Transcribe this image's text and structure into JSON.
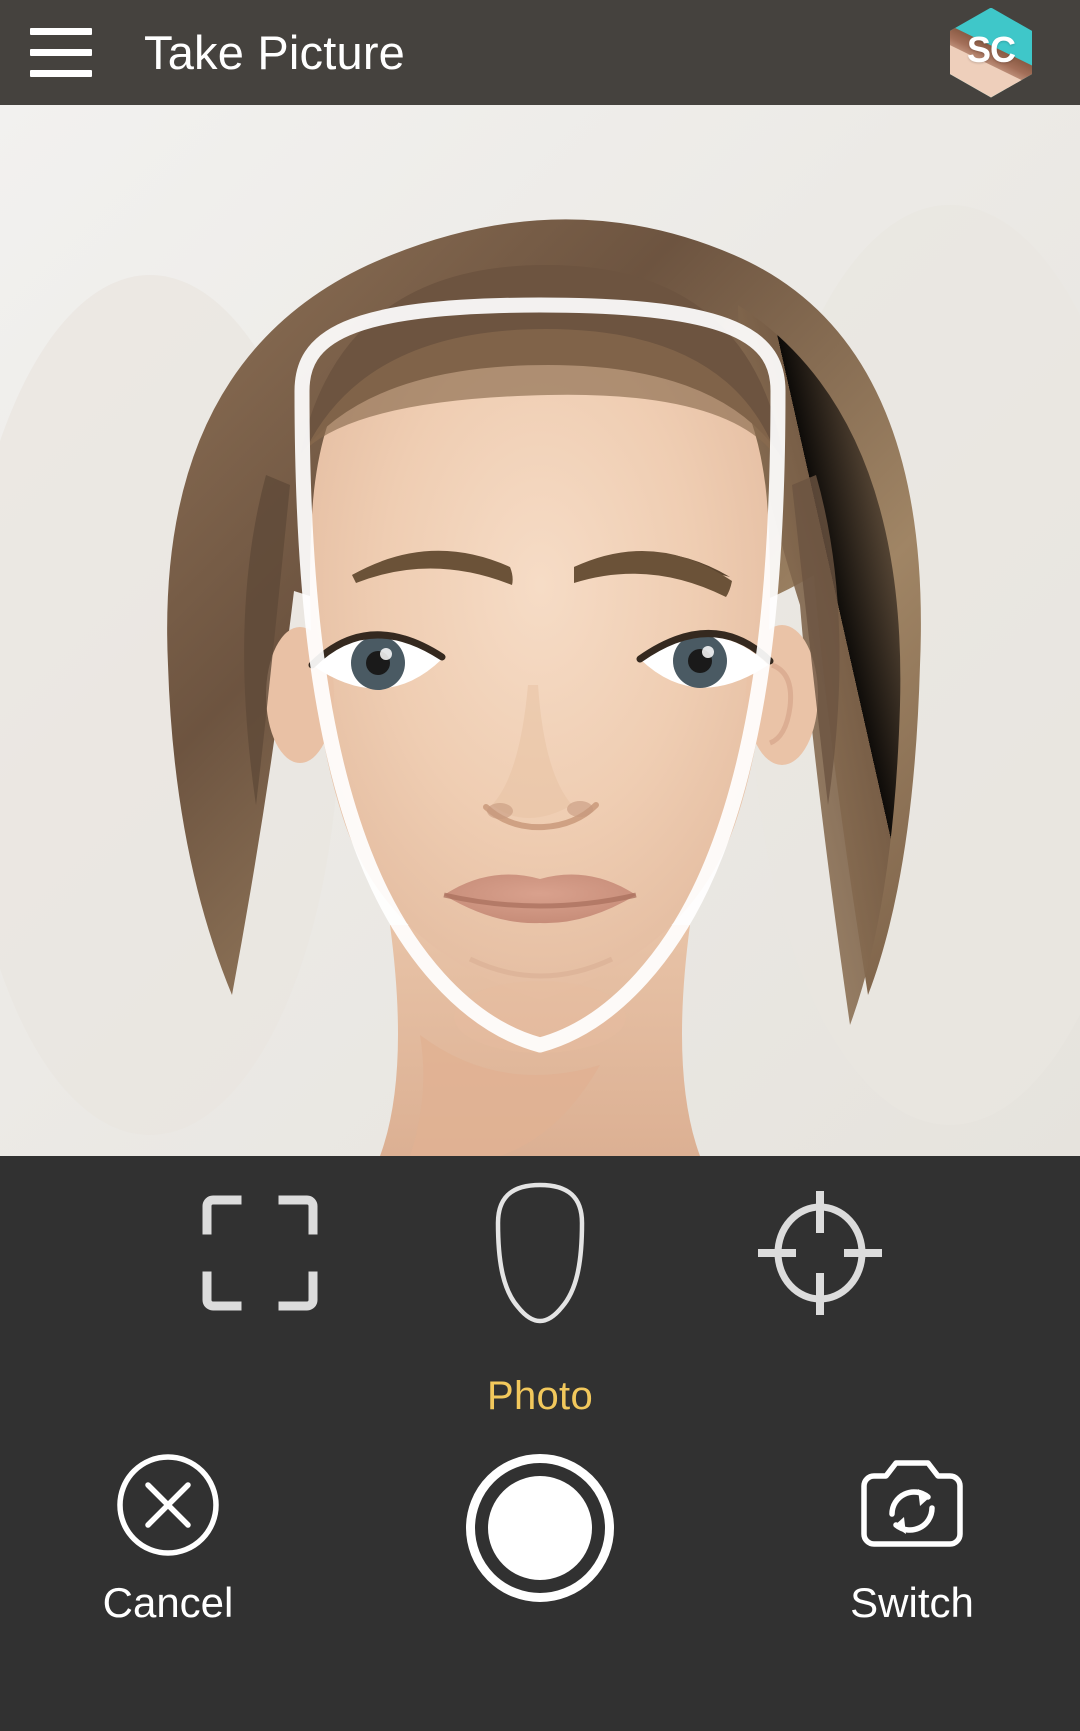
{
  "appbar": {
    "menu_icon": "hamburger-menu-icon",
    "title": "Take Picture",
    "logo": {
      "icon": "app-logo-hexagon-icon",
      "text": "SC",
      "background_color": "#3fc7c9"
    },
    "background_color": "#45423e",
    "title_color": "#ffffff"
  },
  "viewfinder": {
    "subject": "woman face portrait preview",
    "guide_overlay": {
      "icon": "face-outline-guide",
      "color": "#ffffff",
      "description": "white rounded face alignment outline"
    },
    "background_color": "#edecea"
  },
  "controls": {
    "background_color": "#313131",
    "modes": [
      {
        "icon": "crop-frame-icon",
        "name": "crop-frame",
        "selected": false
      },
      {
        "icon": "face-oval-icon",
        "name": "face-oval",
        "selected": true
      },
      {
        "icon": "crosshair-target-icon",
        "name": "crosshair-target",
        "selected": false
      }
    ],
    "mode_label": "Photo",
    "mode_label_color": "#f2c85c",
    "actions": {
      "cancel": {
        "label": "Cancel",
        "icon": "close-circle-icon"
      },
      "shutter": {
        "label": "",
        "icon": "shutter-button-icon"
      },
      "switch": {
        "label": "Switch",
        "icon": "camera-switch-icon"
      }
    },
    "action_label_color": "#ffffff"
  }
}
